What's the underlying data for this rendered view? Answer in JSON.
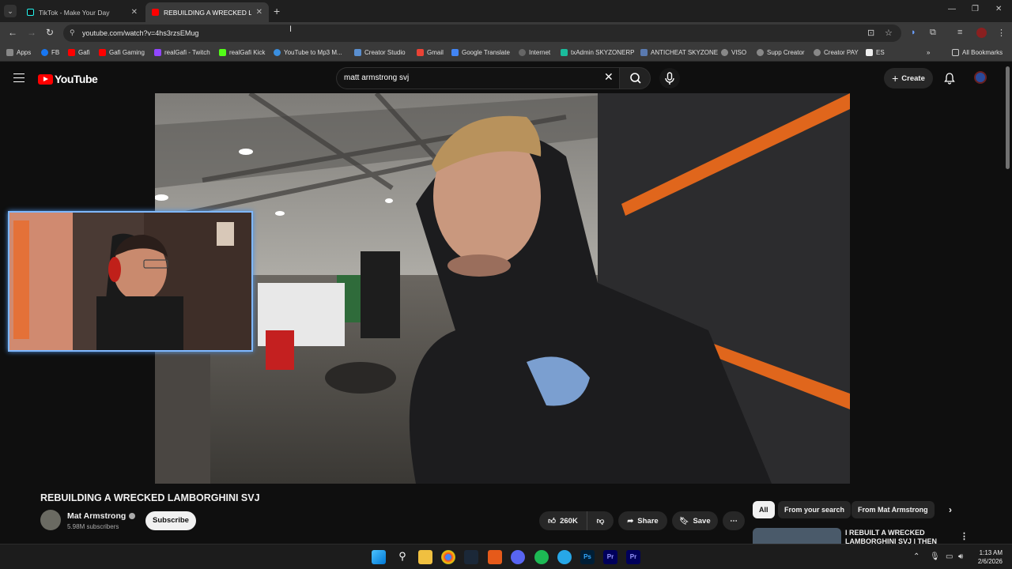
{
  "browser": {
    "tabs": [
      {
        "title": "TikTok - Make Your Day",
        "active": false
      },
      {
        "title": "REBUILDING A WRECKED LAMBORGHINI SVJ",
        "active": true
      }
    ],
    "url": "youtube.com/watch?v=4hs3rzsEMug",
    "bookmarks": [
      "Apps",
      "FB",
      "Gafi",
      "Gafi Gaming",
      "realGafi - Twitch",
      "realGafi Kick",
      "YouTube to Mp3 M...",
      "Creator Studio",
      "Gmail",
      "Google Translate",
      "Internet",
      "txAdmin SKYZONERP",
      "ANTICHEAT SKYZONE",
      "VISO",
      "Supp Creator",
      "Creator PAY",
      "ES"
    ],
    "all_bookmarks": "All Bookmarks"
  },
  "youtube": {
    "logo_text": "YouTube",
    "search_value": "matt armstrong svj",
    "create_label": "Create",
    "video_title": "REBUILDING A WRECKED LAMBORGHINI SVJ",
    "channel_name": "Mat Armstrong",
    "subscribers": "5.98M subscribers",
    "subscribe_label": "Subscribe",
    "likes": "260K",
    "share_label": "Share",
    "save_label": "Save",
    "chips": [
      "All",
      "From your search",
      "From Mat Armstrong"
    ],
    "recommended_title": "I REBUILT A WRECKED LAMBORGHINI SVJ | THEN"
  },
  "taskbar": {
    "time": "1:13 AM",
    "date": "2/6/2026"
  },
  "colors": {
    "brand_red": "#ff0000",
    "cam_border": "#7fb8ff"
  }
}
